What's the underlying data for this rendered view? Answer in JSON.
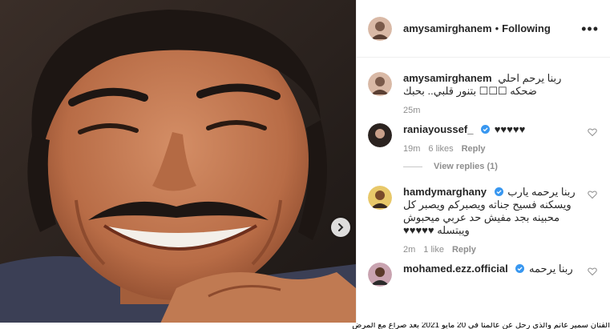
{
  "header": {
    "username": "amysamirghanem",
    "separator": "•",
    "follow_status": "Following",
    "more_label": "•••"
  },
  "photo": {
    "subject": "smiling man with mustache",
    "next_icon": "chevron-right-icon"
  },
  "comments": [
    {
      "username": "amysamirghanem",
      "text": "ربنا يرحم احلي ضحكه ☐☐☐ بتنور قلبي.. بحبك",
      "time": "25m",
      "likes": "",
      "reply": "",
      "verified": false
    },
    {
      "username": "raniayoussef_",
      "text": "♥♥♥♥♥",
      "time": "19m",
      "likes": "6 likes",
      "reply": "Reply",
      "verified": true,
      "view_replies": "View replies (1)"
    },
    {
      "username": "hamdymarghany",
      "text": "ربنا يرحمه يارب ويسكنه فسيح جناته ويصبركم ويصبر كل محبينه بجد مفيش حد عربي ميحبوش ويبتسله ♥♥♥♥♥",
      "time": "2m",
      "likes": "1 like",
      "reply": "Reply",
      "verified": true
    },
    {
      "username": "mohamed.ezz.official",
      "text": "ربنا يرحمه",
      "time": "",
      "likes": "",
      "reply": "",
      "verified": true
    }
  ],
  "colors": {
    "text": "#262626",
    "muted": "#8e8e8e",
    "verified": "#3897f0",
    "border": "#efefef"
  },
  "bottom_caption": "الفنان سمير غانم والذي رحل عن عالمنا في 20 مايو 2021 بعد صراع مع المرض"
}
